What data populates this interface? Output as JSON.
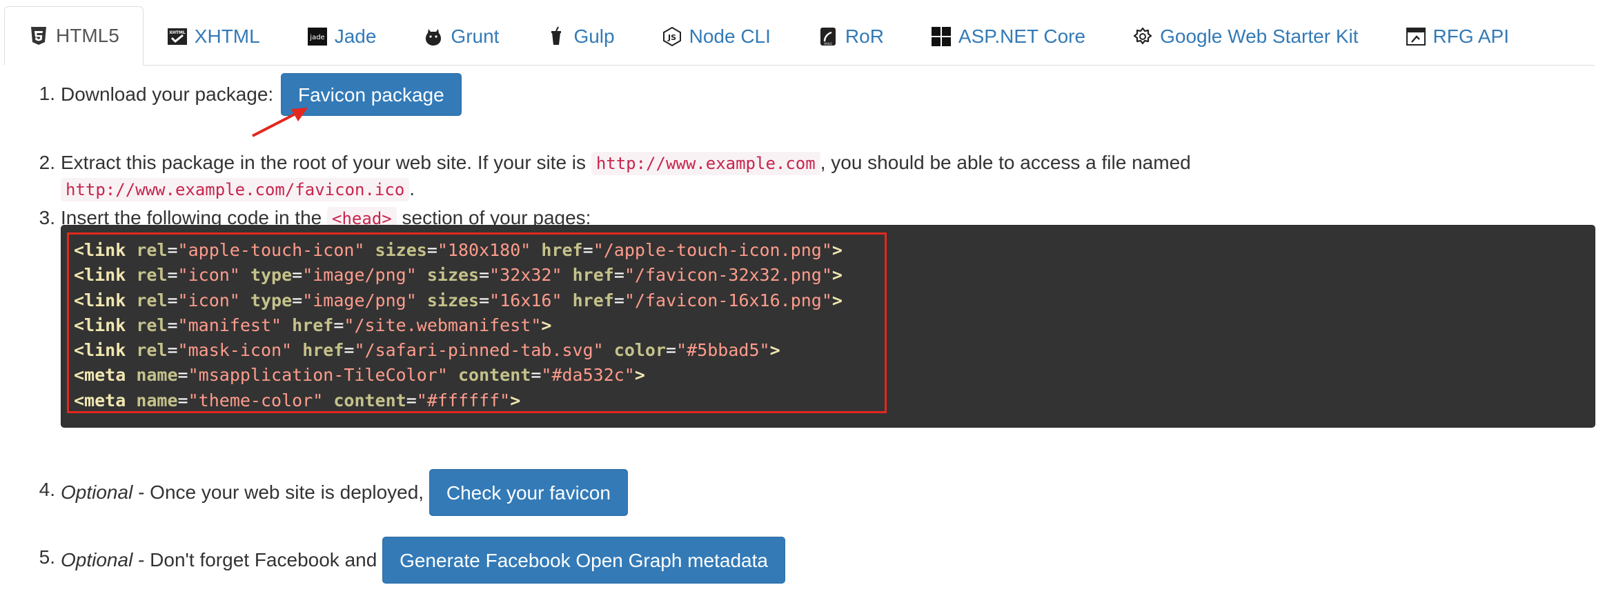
{
  "tabs": [
    {
      "label": "HTML5",
      "icon": "html5-icon",
      "active": true
    },
    {
      "label": "XHTML",
      "icon": "xhtml-icon",
      "active": false
    },
    {
      "label": "Jade",
      "icon": "jade-icon",
      "active": false
    },
    {
      "label": "Grunt",
      "icon": "grunt-icon",
      "active": false
    },
    {
      "label": "Gulp",
      "icon": "gulp-icon",
      "active": false
    },
    {
      "label": "Node CLI",
      "icon": "nodejs-icon",
      "active": false
    },
    {
      "label": "RoR",
      "icon": "rails-icon",
      "active": false
    },
    {
      "label": "ASP.NET Core",
      "icon": "windows-icon",
      "active": false
    },
    {
      "label": "Google Web Starter Kit",
      "icon": "gear-icon",
      "active": false
    },
    {
      "label": "RFG API",
      "icon": "api-icon",
      "active": false
    }
  ],
  "steps": {
    "s1": {
      "num": "1.",
      "text": "Download your package:",
      "button": "Favicon package"
    },
    "s2": {
      "num": "2.",
      "text_a": "Extract this package in the root of your web site. If your site is",
      "code_a": "http://www.example.com",
      "text_b": ", you should be able to access a file named",
      "code_b": "http://www.example.com/favicon.ico",
      "text_c": "."
    },
    "s3": {
      "num": "3.",
      "text_a": "Insert the following code in the",
      "code": "<head>",
      "text_b": "section of your pages:"
    },
    "s4": {
      "num": "4.",
      "optional": "Optional",
      "text": "- Once your web site is deployed,",
      "button": "Check your favicon"
    },
    "s5": {
      "num": "5.",
      "optional": "Optional",
      "text": "- Don't forget Facebook and",
      "button": "Generate Facebook Open Graph metadata"
    }
  },
  "code_lines": [
    "<link rel=\"apple-touch-icon\" sizes=\"180x180\" href=\"/apple-touch-icon.png\">",
    "<link rel=\"icon\" type=\"image/png\" sizes=\"32x32\" href=\"/favicon-32x32.png\">",
    "<link rel=\"icon\" type=\"image/png\" sizes=\"16x16\" href=\"/favicon-16x16.png\">",
    "<link rel=\"manifest\" href=\"/site.webmanifest\">",
    "<link rel=\"mask-icon\" href=\"/safari-pinned-tab.svg\" color=\"#5bbad5\">",
    "<meta name=\"msapplication-TileColor\" content=\"#da532c\">",
    "<meta name=\"theme-color\" content=\"#ffffff\">"
  ],
  "colors": {
    "primary_button": "#337ab7",
    "link": "#337ab7",
    "code_background": "#333333",
    "highlight_border": "#e3271d",
    "inline_code": "#c7254e"
  }
}
